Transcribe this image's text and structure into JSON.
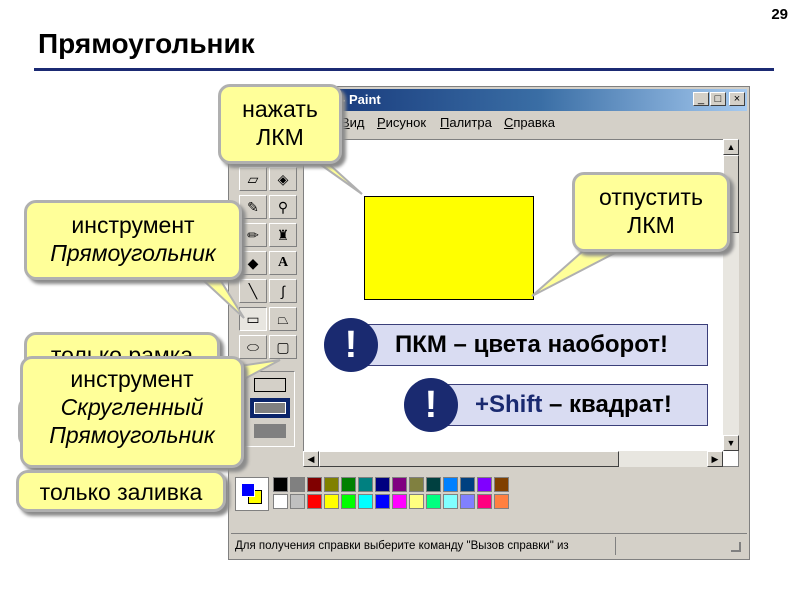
{
  "slide": {
    "number": "29",
    "title": "Прямоугольник"
  },
  "window": {
    "title": "- Paint",
    "buttons": {
      "minimize": "_",
      "maximize": "□",
      "close": "×"
    },
    "menu": [
      {
        "label": "Вид",
        "key": "В"
      },
      {
        "label": "Рисунок",
        "key": "Р"
      },
      {
        "label": "Палитра",
        "key": "П"
      },
      {
        "label": "Справка",
        "key": "С"
      }
    ],
    "status": "Для получения справки выберите команду \"Вызов справки\" из"
  },
  "callouts": {
    "press": "нажать\nЛКМ",
    "release": "отпустить\nЛКМ",
    "tool_rect_line1": "инструмент",
    "tool_rect_line2": "Прямоугольник",
    "only_frame": "только рамка",
    "tool_rounded_line1": "инструмент",
    "tool_rounded_line2": "Скругленный",
    "tool_rounded_line3": "Прямоугольник",
    "only_fill": "только заливка"
  },
  "tips": {
    "rmb": "ПКМ – цвета наоборот!",
    "shift_key": "+Shift",
    "shift_rest": " – квадрат!",
    "bang": "!"
  },
  "colors": {
    "accent": "#1a2a70",
    "callout_fill": "#ffff99",
    "drawn_rect": "#ffff00",
    "palette_top": [
      "#000000",
      "#808080",
      "#800000",
      "#808000",
      "#008000",
      "#008080",
      "#000080",
      "#800080",
      "#808040",
      "#004040",
      "#0080ff",
      "#004080",
      "#8000ff",
      "#804000"
    ],
    "palette_bottom": [
      "#ffffff",
      "#c0c0c0",
      "#ff0000",
      "#ffff00",
      "#00ff00",
      "#00ffff",
      "#0000ff",
      "#ff00ff",
      "#ffff80",
      "#00ff80",
      "#80ffff",
      "#8080ff",
      "#ff0080",
      "#ff8040"
    ]
  }
}
